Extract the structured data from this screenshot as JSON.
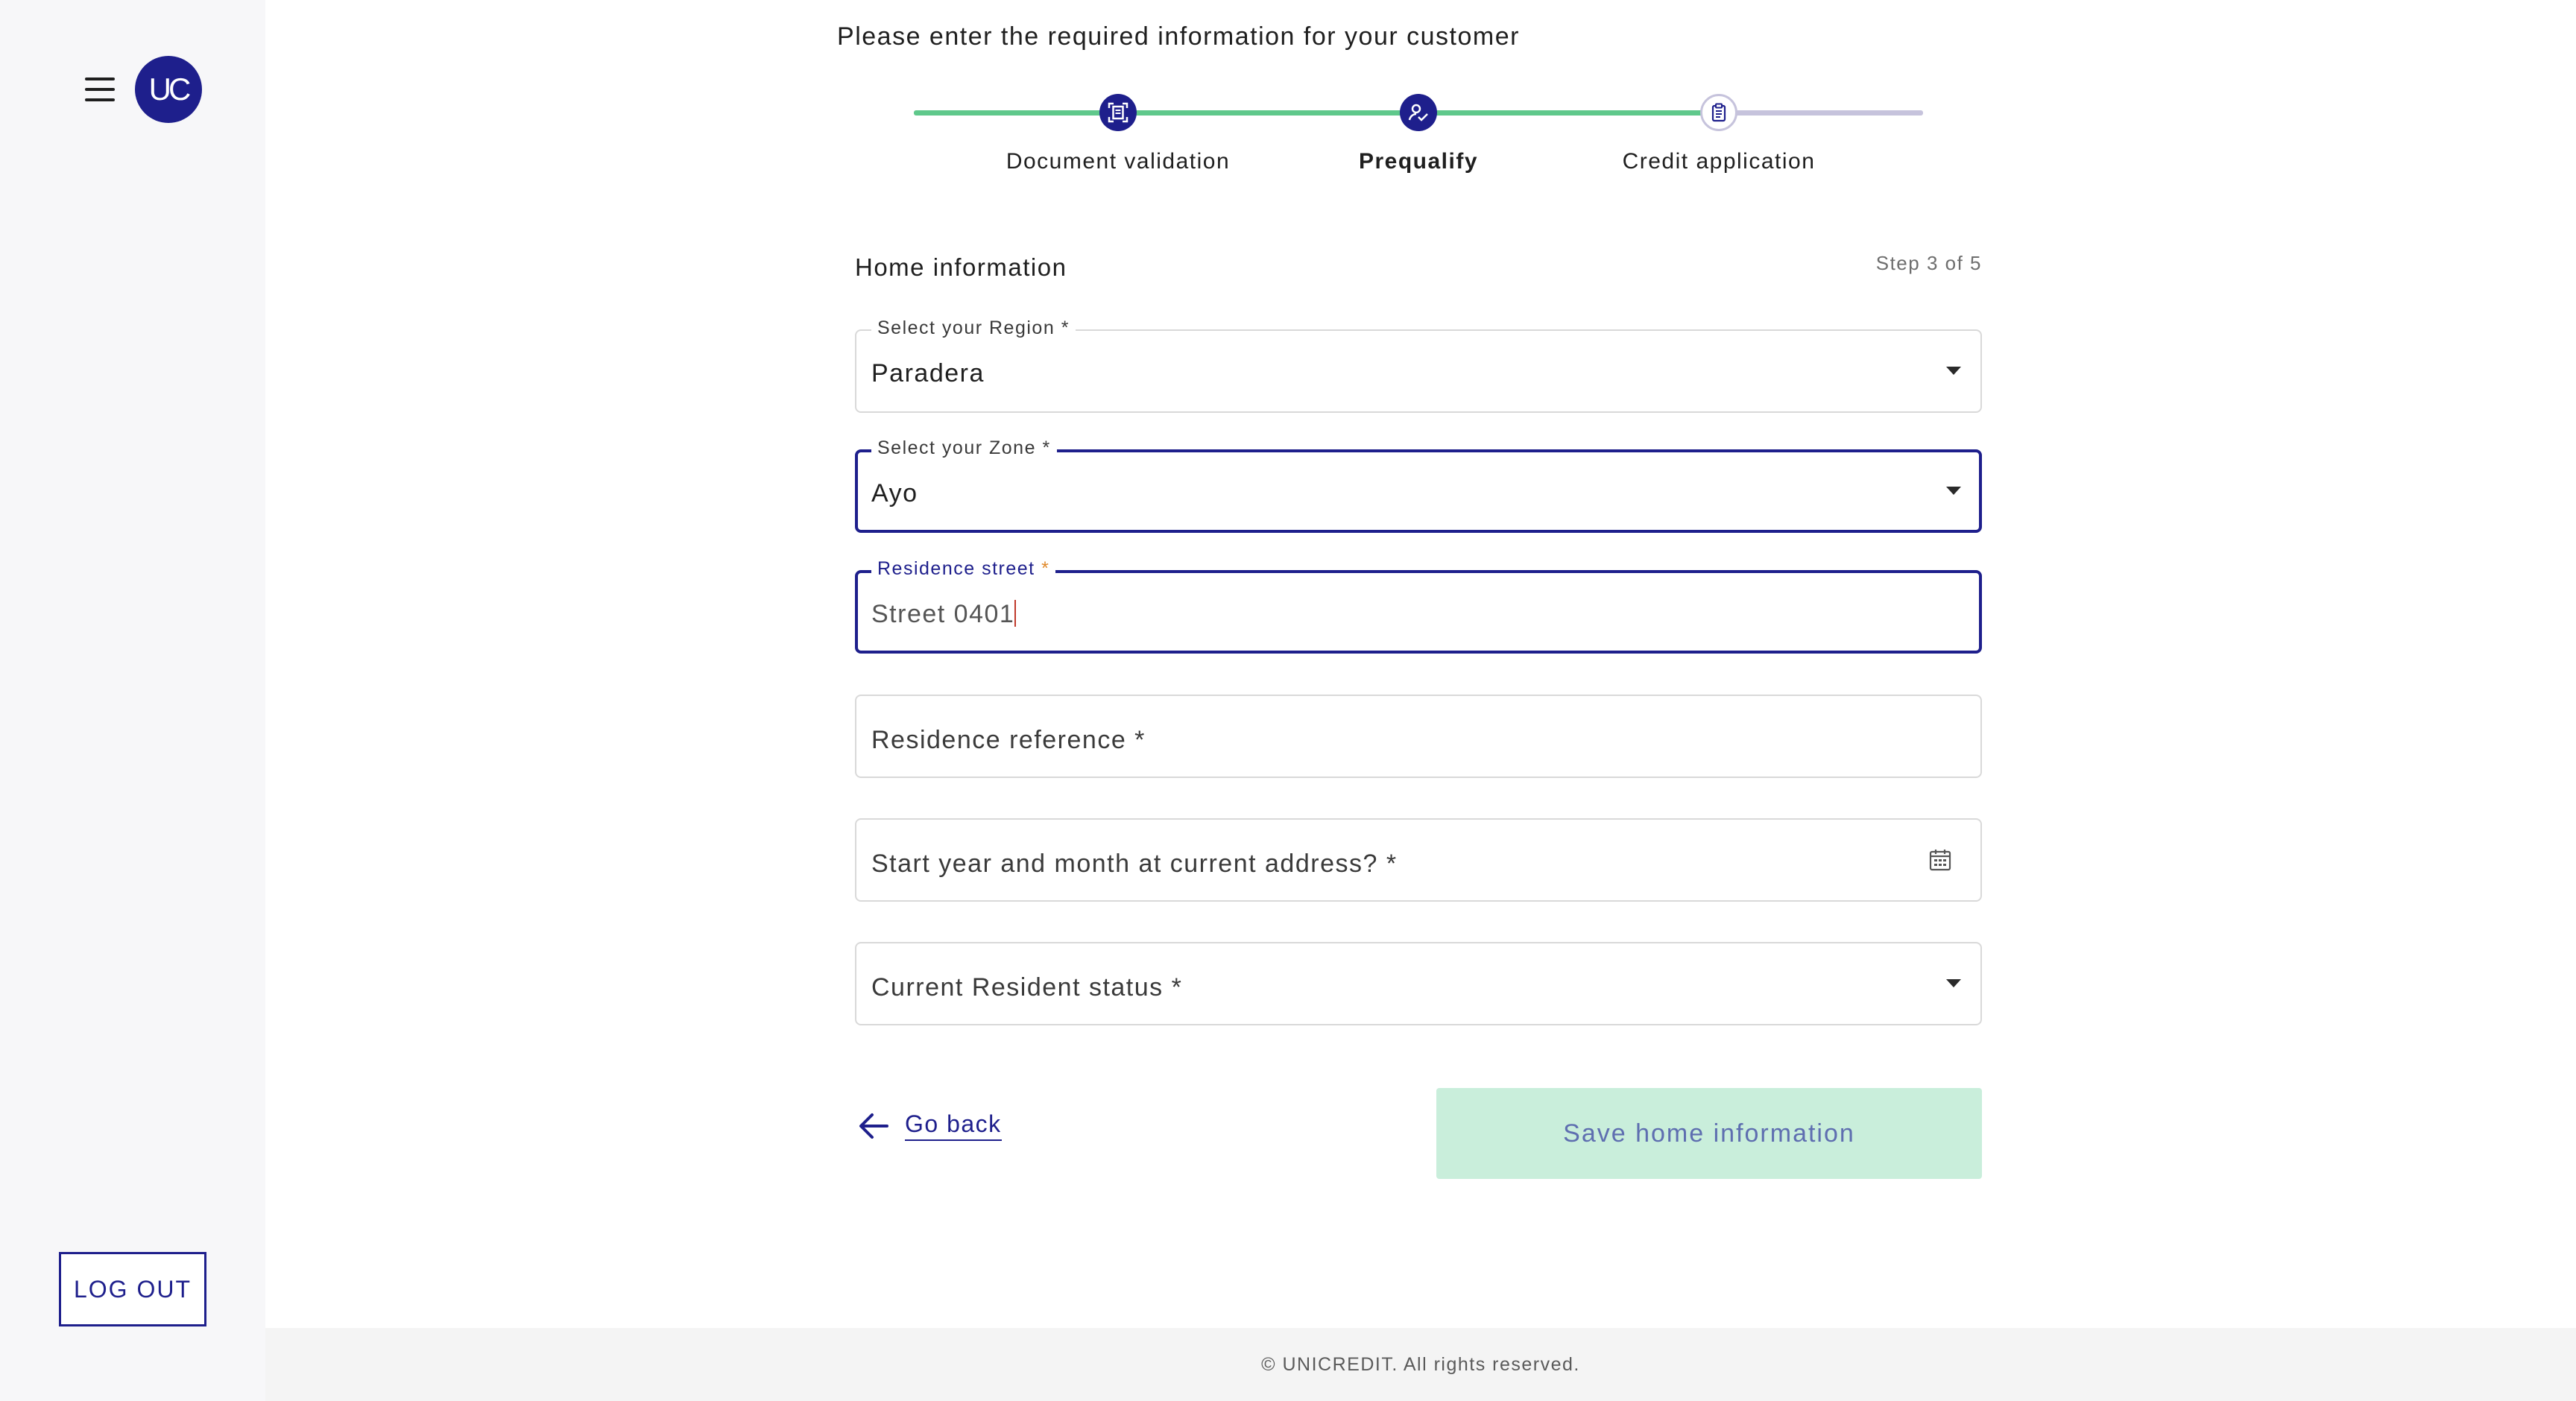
{
  "sidebar": {
    "avatar_initials": "UC",
    "logout_label": "LOG OUT"
  },
  "header": {
    "instruction": "Please enter the required information for your customer"
  },
  "stepper": {
    "steps": [
      {
        "label": "Document validation",
        "status": "completed",
        "icon": "document-scan-icon"
      },
      {
        "label": "Prequalify",
        "status": "active",
        "icon": "user-check-icon"
      },
      {
        "label": "Credit application",
        "status": "pending",
        "icon": "clipboard-icon"
      }
    ]
  },
  "form": {
    "title": "Home information",
    "step_indicator": "Step 3 of 5",
    "region": {
      "label": "Select your Region",
      "required_mark": "*",
      "value": "Paradera"
    },
    "zone": {
      "label": "Select your Zone",
      "required_mark": "*",
      "value": "Ayo"
    },
    "street": {
      "label": "Residence street",
      "required_mark": "*",
      "value": "Street 0401"
    },
    "reference": {
      "placeholder": "Residence reference *"
    },
    "start_date": {
      "placeholder": "Start year and month at current address? *"
    },
    "resident_status": {
      "placeholder": "Current Resident status *"
    }
  },
  "actions": {
    "back_label": "Go back",
    "save_label": "Save home information"
  },
  "footer": {
    "copyright": "© UNICREDIT. All rights reserved."
  },
  "colors": {
    "primary": "#1e1f8c",
    "progress_done": "#5fc88b",
    "progress_todo": "#c6c3dc",
    "save_button_disabled_bg": "#c9eedb"
  }
}
